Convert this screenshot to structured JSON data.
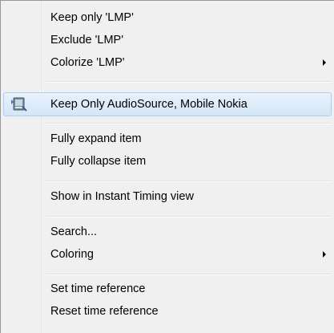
{
  "menu": {
    "items": [
      {
        "label": "Keep only 'LMP'"
      },
      {
        "label": "Exclude 'LMP'"
      },
      {
        "label": "Colorize 'LMP'"
      },
      {
        "label": "Keep Only AudioSource, Mobile Nokia",
        "icon": "filter-keep-icon"
      },
      {
        "label": "Fully expand item"
      },
      {
        "label": "Fully collapse item"
      },
      {
        "label": "Show in Instant Timing view"
      },
      {
        "label": "Search..."
      },
      {
        "label": "Coloring"
      },
      {
        "label": "Set time reference"
      },
      {
        "label": "Reset time reference"
      }
    ],
    "highlight_color": "#d4e6f8",
    "highlight_border": "#a9cdf3"
  }
}
